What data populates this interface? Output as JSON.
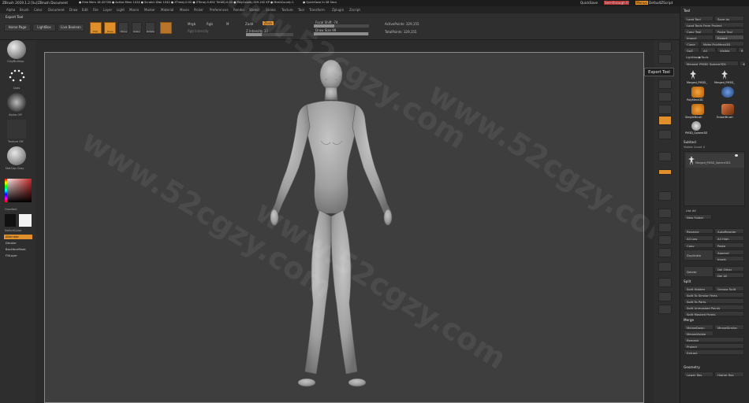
{
  "titlebar": {
    "app": "ZBrush 2019.1.2 [liu]",
    "doc": "ZBrush Document",
    "stats": "● Free Mem 18.427GB ● Active Mem 1414 ● Scratch Disk 1042 ● ZTime▷0.02 ● ZTime▷5.692 Timer▷0.02 ● PolyCount▷329.242 KP ● MeshCount▷1",
    "quicksave_status": "● QuickSave In 58 Secs",
    "quicksave": "QuickSave",
    "see_through": "See-through 0",
    "menus": "Menus",
    "default_script": "DefaultZScript"
  },
  "menubar": [
    "Alpha",
    "Brush",
    "Color",
    "Document",
    "Draw",
    "Edit",
    "File",
    "Layer",
    "Light",
    "Macro",
    "Marker",
    "Material",
    "Movie",
    "Picker",
    "Preferences",
    "Render",
    "Stencil",
    "Stroke",
    "Texture",
    "Tool",
    "Transform",
    "Zplugin",
    "Zscript"
  ],
  "shelf": {
    "export_tool": "Export Tool",
    "home_page": "Home Page",
    "lightbox": "LightBox",
    "live_boolean": "Live Boolean",
    "edit": "Edit",
    "draw": "Draw",
    "move": "Move",
    "scale": "Scale",
    "rotate": "Rotate",
    "mrgb": "Mrgb",
    "rgb": "Rgb",
    "m": "M",
    "zadd": "Zadd",
    "zsub": "Zsub",
    "rgb_intensity": "Rgb Intensity",
    "z_intensity": "Z Intensity 33",
    "focal_shift": "Focal Shift -74",
    "draw_size": "Draw Size 99",
    "active_points": "ActivePoints: 329,155",
    "total_points": "TotalPoints: 329,155",
    "z_intensity_level": 0.33,
    "draw_size_level": 0.99,
    "focal_shift_level": 0.37
  },
  "left_tray": {
    "brush": "ClayBuildup",
    "stroke": "Dots",
    "alpha": "Alpha Off",
    "texture": "Texture Off",
    "material": "MatCap Gray",
    "gradient": "Gradient",
    "switch_color": "SwitchColor",
    "alternate": "Alternate",
    "decolor": "Decolor",
    "backface_mask": "BackfaceMask",
    "fill_layer": "FillLayer"
  },
  "right_shelf": {
    "icons": [
      "BPR",
      "SPix 3",
      "Scroll",
      "Zoom",
      "Actual",
      "AAHalf",
      "Persp",
      "Floor",
      "L.Sym",
      "Xyz",
      "Frame",
      "Move",
      "Scale",
      "Rotate",
      "Line Fill PolyF",
      "Transp",
      "Ghost",
      "Solo",
      "Xpose"
    ]
  },
  "tooltip": "Export Tool",
  "palette": {
    "title": "Tool",
    "load_tool": "Load Tool",
    "save_as": "Save As",
    "load_tools_from_project": "Load Tools From Project",
    "copy_tool": "Copy Tool",
    "paste_tool": "Paste Tool",
    "import": "Import",
    "export": "Export",
    "clone": "Clone",
    "make_polymesh": "Make PolyMesh3D",
    "goz": "GoZ",
    "all": "All",
    "visible": "Visible",
    "r": "R",
    "lightbox_tools": "Lightbox▶Tools",
    "current_tool": "Merged_PM3D_Sphere3D1",
    "current_tool_count": "48",
    "thumbs": [
      "",
      "Merged_PM3D_",
      "Merged_PM3D_",
      "PolyMesh3D",
      "SimpleBrush",
      "EraserBrush",
      "PM3D_Sphere3D"
    ],
    "subtool_header": "Subtool",
    "visible_count": "Visible Count 4",
    "subtool_name": "Merged_PM3D_Sphere3D1",
    "list_all": "List All",
    "new_folder": "New Folder",
    "rename": "Rename",
    "autoreorder": "AutoReorder",
    "all_low": "All Low",
    "all_high": "All High",
    "copy": "Copy",
    "paste": "Paste",
    "duplicate": "Duplicate",
    "append": "Append",
    "insert": "Insert",
    "delete": "Delete",
    "del_other": "Del Other",
    "del_all": "Del All",
    "split": "Split",
    "split_hidden": "Split Hidden",
    "groups_split": "Groups Split",
    "split_to_similar": "Split To Similar Parts",
    "split_to_parts": "Split To Parts",
    "split_unmasked": "Split Unmasked Points",
    "split_masked": "Split Masked Points",
    "merge": "Merge",
    "merge_down": "MergeDown",
    "merge_similar": "MergeSimilar",
    "merge_visible": "MergeVisible",
    "remesh": "Remesh",
    "project": "Project",
    "extract": "Extract",
    "geometry": "Geometry",
    "lower_res": "Lower Res",
    "higher_res": "Higher Res"
  },
  "watermark": "www.52cgzy.com",
  "colors": {
    "accent": "#e0902a",
    "bg": "#2b2b2b",
    "viewport": "#3e3e3e"
  }
}
